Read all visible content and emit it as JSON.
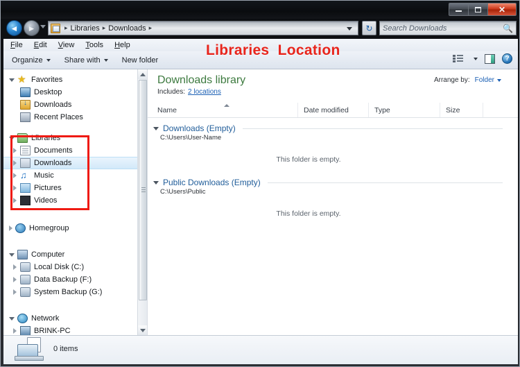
{
  "window": {
    "controls": {
      "minimize": "–",
      "maximize": "□",
      "close": "✕"
    }
  },
  "addressbar": {
    "back_icon": "◄",
    "forward_icon": "►",
    "crumbs": [
      "Libraries",
      "Downloads"
    ],
    "separator": "▸",
    "refresh_icon": "↻",
    "search": {
      "placeholder": "Search Downloads",
      "value": "",
      "icon": "🔍"
    }
  },
  "menubar": {
    "items": [
      {
        "accel": "F",
        "rest": "ile"
      },
      {
        "accel": "E",
        "rest": "dit"
      },
      {
        "accel": "V",
        "rest": "iew"
      },
      {
        "accel": "T",
        "rest": "ools"
      },
      {
        "accel": "H",
        "rest": "elp"
      }
    ]
  },
  "toolbar": {
    "organize": "Organize",
    "share_with": "Share with",
    "new_folder": "New folder",
    "views_icon": "views-icon",
    "preview_pane_icon": "preview-pane-icon",
    "help_icon": "?"
  },
  "annotation": {
    "text": "Libraries  Location",
    "color": "#e8251c"
  },
  "sidebar": {
    "groups": [
      {
        "header": {
          "label": "Favorites",
          "icon": "star-icon",
          "expanded": true
        },
        "items": [
          {
            "label": "Desktop",
            "icon": "monitor-icon"
          },
          {
            "label": "Downloads",
            "icon": "downloads-folder-icon"
          },
          {
            "label": "Recent Places",
            "icon": "recent-places-icon"
          }
        ]
      },
      {
        "header": {
          "label": "Libraries",
          "icon": "libraries-icon",
          "expanded": true
        },
        "items": [
          {
            "label": "Documents",
            "icon": "documents-library-icon"
          },
          {
            "label": "Downloads",
            "icon": "downloads-library-icon",
            "selected": true
          },
          {
            "label": "Music",
            "icon": "music-library-icon"
          },
          {
            "label": "Pictures",
            "icon": "pictures-library-icon"
          },
          {
            "label": "Videos",
            "icon": "videos-library-icon"
          }
        ]
      },
      {
        "header": {
          "label": "Homegroup",
          "icon": "homegroup-icon",
          "expanded": false
        },
        "items": []
      },
      {
        "header": {
          "label": "Computer",
          "icon": "computer-icon",
          "expanded": true
        },
        "items": [
          {
            "label": "Local Disk (C:)",
            "icon": "local-disk-icon"
          },
          {
            "label": "Data Backup (F:)",
            "icon": "drive-icon"
          },
          {
            "label": "System Backup (G:)",
            "icon": "drive-icon"
          }
        ]
      },
      {
        "header": {
          "label": "Network",
          "icon": "network-icon",
          "expanded": true
        },
        "items": [
          {
            "label": "BRINK-PC",
            "icon": "network-pc-icon"
          }
        ]
      }
    ]
  },
  "content": {
    "library_title": "Downloads library",
    "includes_label": "Includes:",
    "includes_link": "2 locations",
    "arrange_label": "Arrange by:",
    "arrange_value": "Folder",
    "columns": [
      "Name",
      "Date modified",
      "Type",
      "Size"
    ],
    "groups": [
      {
        "name": "Downloads (Empty)",
        "path": "C:\\Users\\User-Name",
        "empty_message": "This folder is empty."
      },
      {
        "name": "Public Downloads (Empty)",
        "path": "C:\\Users\\Public",
        "empty_message": "This folder is empty."
      }
    ]
  },
  "statusbar": {
    "item_count": "0 items",
    "icon": "library-status-icon"
  }
}
